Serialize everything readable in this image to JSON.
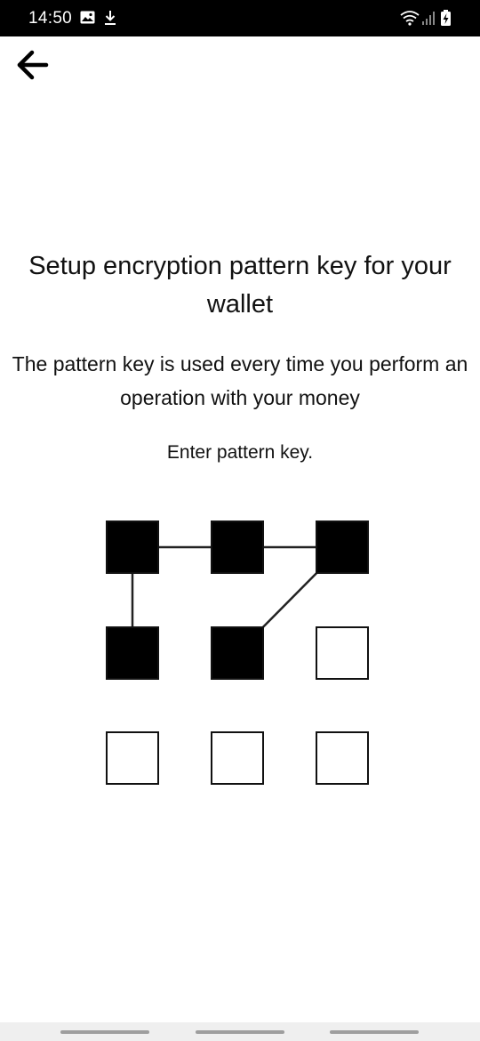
{
  "status_bar": {
    "time": "14:50",
    "icons": [
      "image-icon",
      "download-icon",
      "wifi-icon",
      "signal-icon",
      "battery-charging-icon"
    ]
  },
  "app_bar": {
    "back_icon": "arrow-left-icon"
  },
  "content": {
    "title": "Setup encryption pattern key for your wallet",
    "subtitle": "The pattern key is used every time you perform an operation with your money",
    "prompt": "Enter pattern key."
  },
  "pattern_grid": {
    "rows": 3,
    "cols": 3,
    "selected_nodes": [
      1,
      2,
      3,
      4,
      5
    ],
    "entered_sequence": [
      4,
      1,
      2,
      3,
      5
    ],
    "colors": {
      "selected": "#000000",
      "unselected": "#ffffff",
      "border": "#111111",
      "line": "#222222"
    }
  },
  "nav_bar": {
    "pill_color": "#9e9e9e",
    "background": "#efefef"
  }
}
